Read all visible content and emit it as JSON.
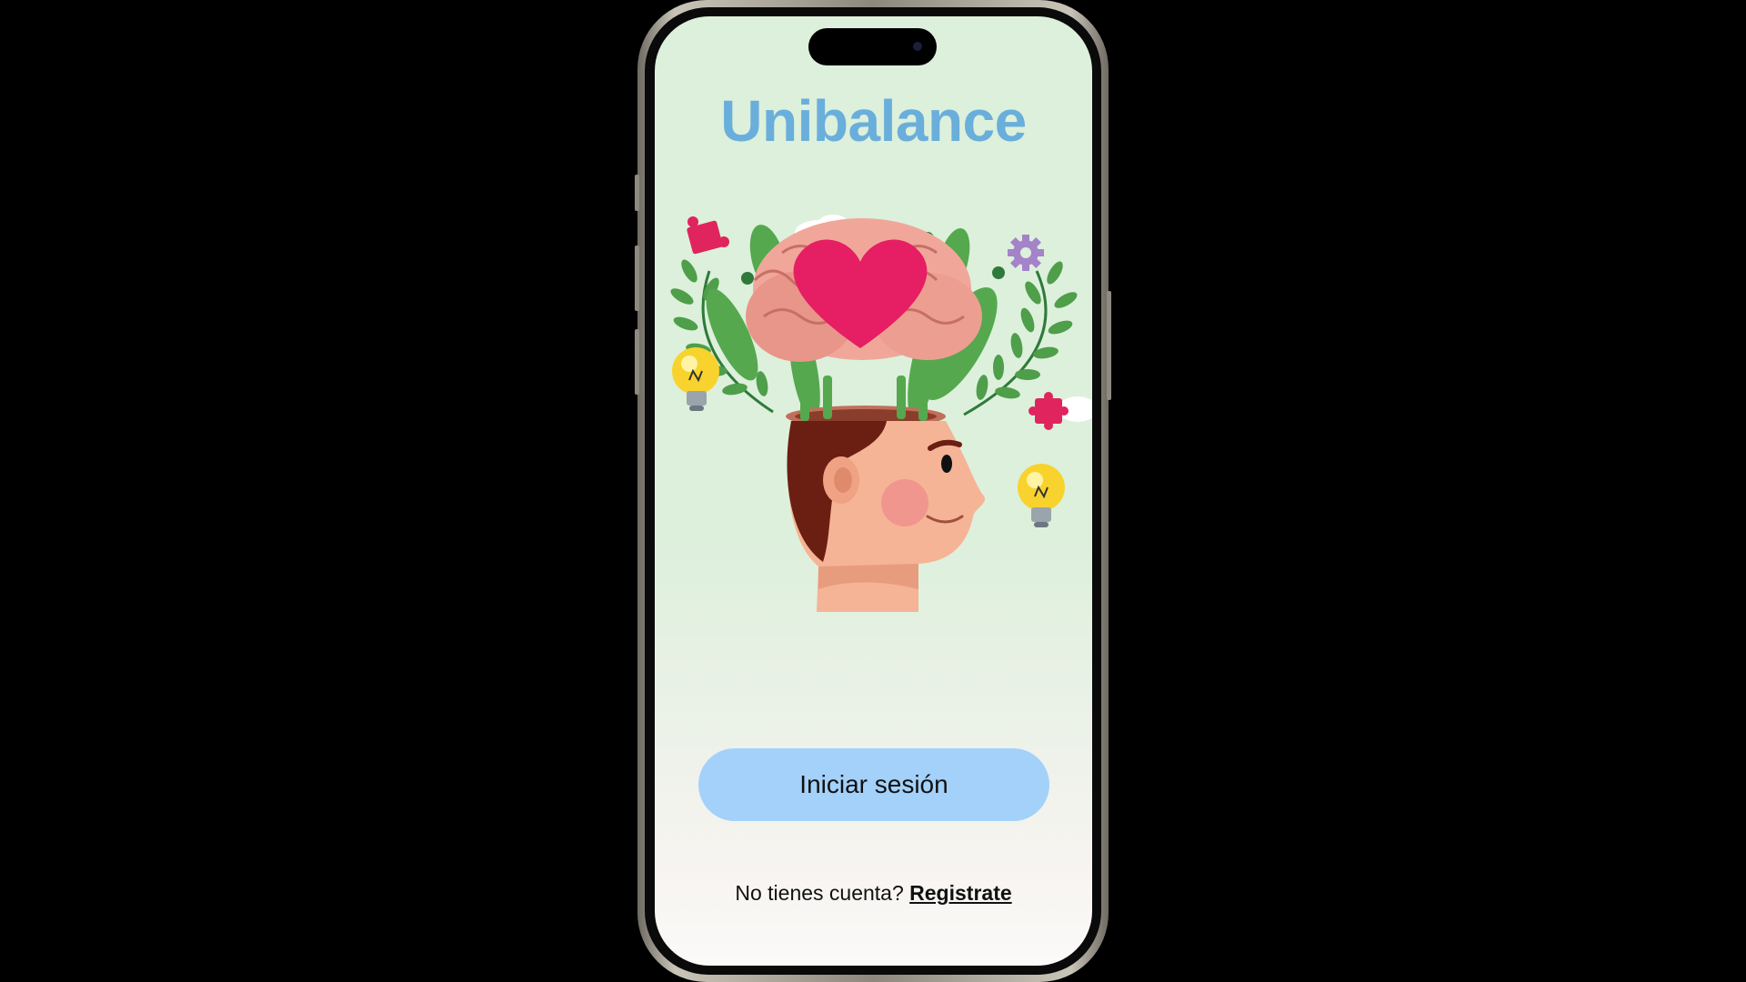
{
  "app": {
    "title": "Unibalance"
  },
  "illustration": {
    "icon": "mind-wellbeing-illustration"
  },
  "actions": {
    "login_label": "Iniciar sesión",
    "signup_prompt": "No tienes cuenta?",
    "signup_link": "Registrate"
  },
  "colors": {
    "title": "#6aaedb",
    "button_bg": "#a3d1fa",
    "background_top": "#dcf0db",
    "background_bottom": "#fbfaf8",
    "heart": "#e61e63"
  }
}
